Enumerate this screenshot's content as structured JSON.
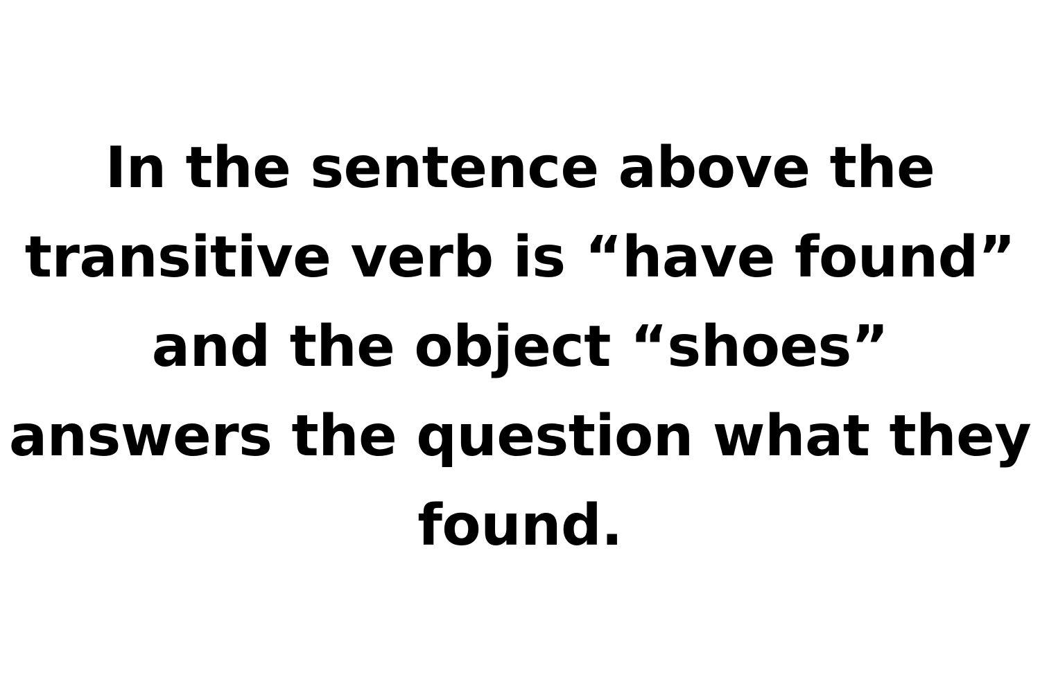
{
  "text": {
    "line_1": "In the sentence above the",
    "line_2": "transitive verb is “have found”",
    "line_3": "and the object “shoes”",
    "line_4": "answers the question what they",
    "line_5": "found."
  },
  "colors": {
    "background": "#ffffff",
    "text": "#000000"
  }
}
